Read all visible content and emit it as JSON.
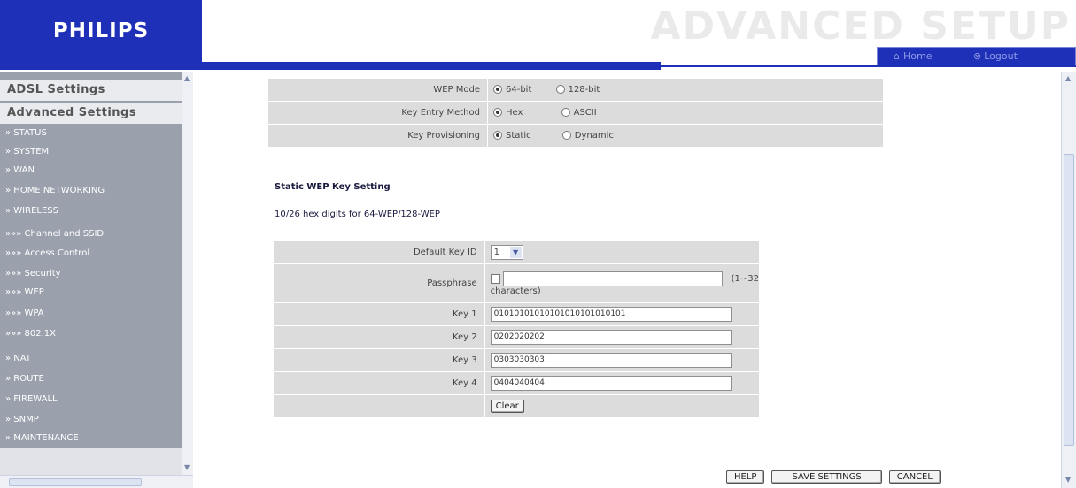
{
  "header": {
    "brand": "PHILIPS",
    "page_title": "ADVANCED SETUP",
    "home_label": "Home",
    "logout_label": "Logout"
  },
  "sidebar": {
    "heading1": "ADSL Settings",
    "heading2": "Advanced Settings",
    "items": [
      "» STATUS",
      "» SYSTEM",
      "» WAN",
      "» HOME NETWORKING",
      "» WIRELESS",
      "»»» Channel and SSID",
      "»»» Access Control",
      "»»» Security",
      "»»» WEP",
      "»»» WPA",
      "»»» 802.1X",
      "» NAT",
      "» ROUTE",
      "» FIREWALL",
      "» SNMP",
      "» MAINTENANCE"
    ]
  },
  "wep": {
    "mode_label": "WEP Mode",
    "mode_opt1": "64-bit",
    "mode_opt2": "128-bit",
    "mode_selected": "64-bit",
    "entry_label": "Key Entry Method",
    "entry_opt1": "Hex",
    "entry_opt2": "ASCII",
    "entry_selected": "Hex",
    "prov_label": "Key Provisioning",
    "prov_opt1": "Static",
    "prov_opt2": "Dynamic",
    "prov_selected": "Static"
  },
  "static_key": {
    "section_title": "Static WEP Key Setting",
    "hint": "10/26 hex digits for 64-WEP/128-WEP",
    "default_key_label": "Default Key ID",
    "default_key_value": "1",
    "passphrase_label": "Passphrase",
    "passphrase_value": "",
    "passphrase_hint_a": "(1~32",
    "passphrase_hint_b": "characters)",
    "key1_label": "Key 1",
    "key1_value": "01010101010101010101010101",
    "key2_label": "Key 2",
    "key2_value": "0202020202",
    "key3_label": "Key 3",
    "key3_value": "0303030303",
    "key4_label": "Key 4",
    "key4_value": "0404040404",
    "clear_label": "Clear"
  },
  "footer": {
    "help_label": "HELP",
    "save_label": "SAVE SETTINGS",
    "cancel_label": "CANCEL"
  }
}
